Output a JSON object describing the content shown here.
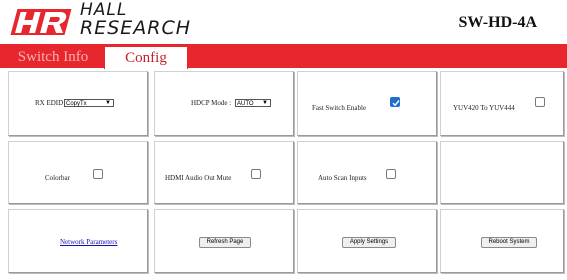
{
  "header": {
    "brand_line1": "HALL",
    "brand_line2": "RESEARCH",
    "logo_letters": "HR",
    "model": "SW-HD-4A"
  },
  "tabs": [
    {
      "label": "Switch Info",
      "active": false
    },
    {
      "label": "Config",
      "active": true
    }
  ],
  "colors": {
    "accent": "#e8262d",
    "checkbox_on": "#1f6fd1",
    "link": "#1a0dab"
  },
  "settings": {
    "rx_edid": {
      "label": "RX EDID",
      "value": "CopyTx"
    },
    "hdcp_mode": {
      "label": "HDCP Mode :",
      "value": "AUTO"
    },
    "fast_switch": {
      "label": "Fast Switch Enable",
      "checked": true
    },
    "yuv": {
      "label": "YUV420 To YUV444",
      "checked": false
    },
    "colorbar": {
      "label": "Colorbar",
      "checked": false
    },
    "hdmi_audio": {
      "label": "HDMI Audio Out Mute",
      "checked": false
    },
    "auto_scan": {
      "label": "Auto Scan Inputs",
      "checked": false
    }
  },
  "actions": {
    "network_link": "Network Parameters",
    "refresh": "Refresh Page",
    "apply": "Apply Settings",
    "reboot": "Reboot System"
  }
}
